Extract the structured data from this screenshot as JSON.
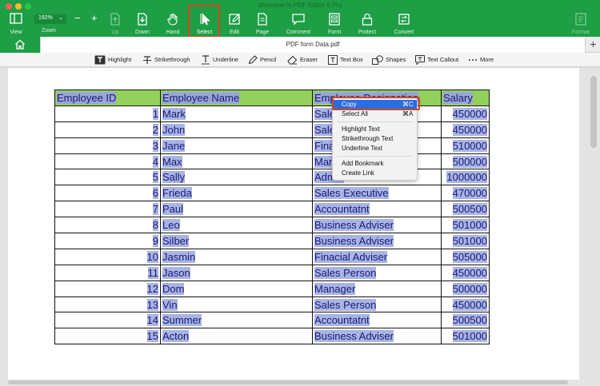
{
  "window": {
    "title": "Welcome to PDF Editor 6 Pro",
    "traffic_lights": [
      "close",
      "minimize",
      "zoom"
    ]
  },
  "toolbar": {
    "view_label": "View",
    "zoom_value": "192%",
    "zoom_label": "Zoom",
    "zoom_minus": "−",
    "zoom_plus": "+",
    "up_label": "Up",
    "down_label": "Down",
    "hand_label": "Hand",
    "select_label": "Select",
    "edit_label": "Edit",
    "page_label": "Page",
    "comment_label": "Comment",
    "form_label": "Form",
    "protect_label": "Protect",
    "convert_label": "Convert",
    "format_label": "Format",
    "active_tool": "select",
    "accent_color": "#1e9e45",
    "highlight_border_color": "#d0471f"
  },
  "tabs": {
    "home_icon": "home-icon",
    "document_title": "PDF form Data.pdf",
    "add_tab": "+"
  },
  "annotation_bar": {
    "highlight": "Highlight",
    "strikethrough": "Strikethrough",
    "underline": "Underline",
    "pencil": "Pencil",
    "eraser": "Eraser",
    "text_box": "Text Box",
    "shapes": "Shapes",
    "text_callout": "Text Callout",
    "more": "More"
  },
  "table": {
    "headers": [
      "Employee ID",
      "Employee Name",
      "Employee Designation",
      "Salary"
    ],
    "rows": [
      {
        "id": "1",
        "name": "Mark",
        "designation": "Sales Executive",
        "salary": "450000"
      },
      {
        "id": "2",
        "name": "John",
        "designation": "Sales Adviser",
        "salary": "450000"
      },
      {
        "id": "3",
        "name": "Jane",
        "designation": "Finacial Adviser",
        "salary": "510000"
      },
      {
        "id": "4",
        "name": "Max",
        "designation": "Manager",
        "salary": "500000"
      },
      {
        "id": "5",
        "name": "Sally",
        "designation": "Admin",
        "salary": "1000000"
      },
      {
        "id": "6",
        "name": "Frieda",
        "designation": "Sales Executive",
        "salary": "470000"
      },
      {
        "id": "7",
        "name": "Paul",
        "designation": "Accountatnt",
        "salary": "500500"
      },
      {
        "id": "8",
        "name": "Leo",
        "designation": "Business Adviser",
        "salary": "501000"
      },
      {
        "id": "9",
        "name": "Silber",
        "designation": "Business Adviser",
        "salary": "501000"
      },
      {
        "id": "10",
        "name": "Jasmin",
        "designation": "Finacial Adviser",
        "salary": "505000"
      },
      {
        "id": "11",
        "name": "Jason",
        "designation": "Sales Person",
        "salary": "450000"
      },
      {
        "id": "12",
        "name": "Dom",
        "designation": "Manager",
        "salary": "500000"
      },
      {
        "id": "13",
        "name": "Vin",
        "designation": "Sales Person",
        "salary": "450000"
      },
      {
        "id": "14",
        "name": "Summer",
        "designation": "Accountatnt",
        "salary": "500500"
      },
      {
        "id": "15",
        "name": "Acton",
        "designation": "Business Adviser",
        "salary": "501000"
      }
    ],
    "header_color": "#94d05c",
    "selection_color": "#a8b4e3"
  },
  "context_menu": {
    "copy": "Copy",
    "copy_shortcut": "⌘C",
    "select_all": "Select All",
    "select_all_shortcut": "⌘A",
    "highlight_text": "Highlight Text",
    "strikethrough_text": "Strikethrough Text",
    "underline_text": "Underline Text",
    "add_bookmark": "Add Bookmark",
    "create_link": "Create Link",
    "active_item": "copy"
  }
}
